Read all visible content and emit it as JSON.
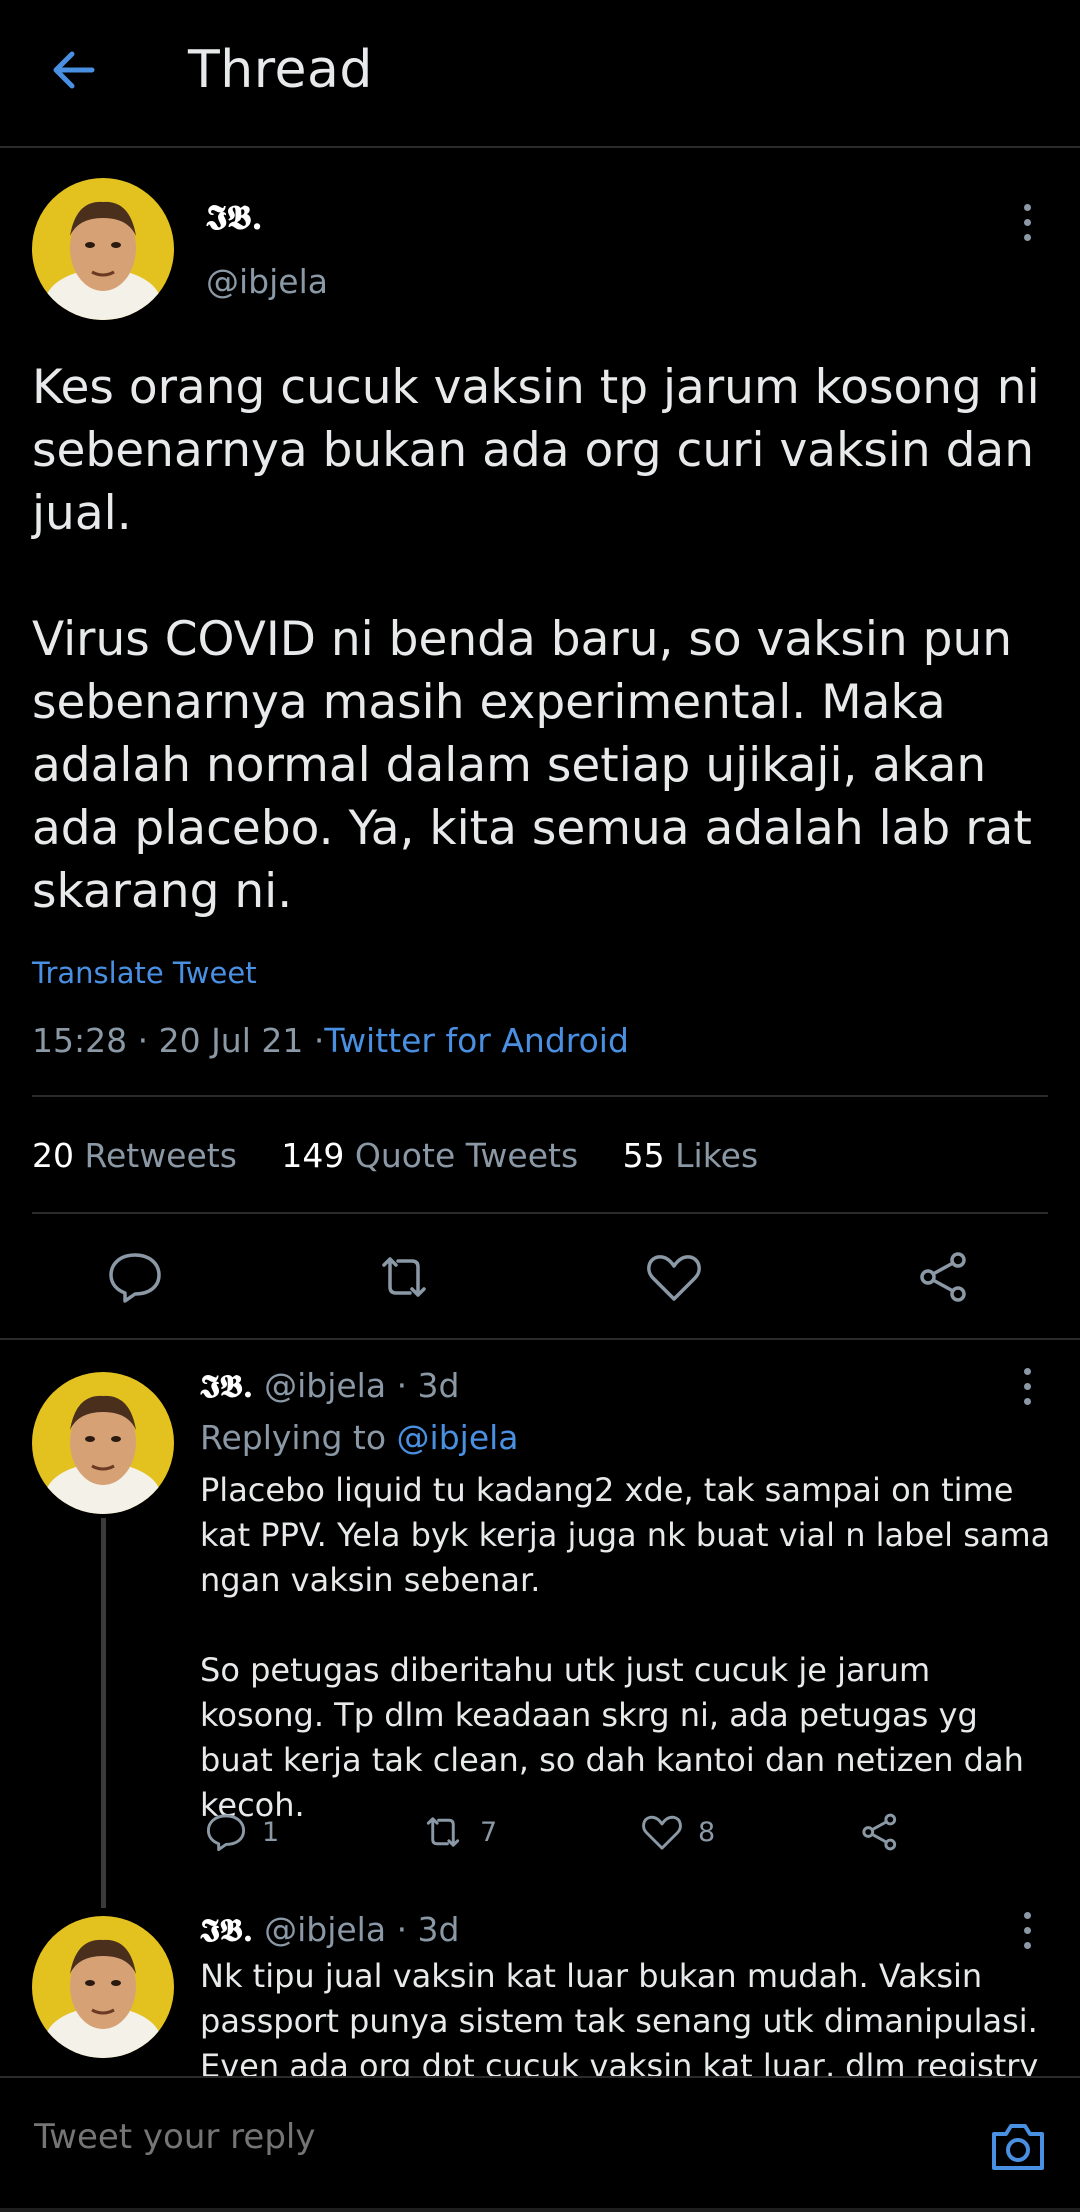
{
  "header": {
    "title": "Thread",
    "back_icon": "arrow-left-icon"
  },
  "main_tweet": {
    "name": "𝕴𝕭.",
    "handle": "@ibjela",
    "text": "Kes orang cucuk vaksin tp jarum kosong ni sebenarnya bukan ada org curi vaksin dan jual.\n\nVirus COVID ni benda baru, so vaksin pun sebenarnya masih experimental. Maka adalah normal dalam setiap ujikaji, akan ada placebo. Ya, kita semua adalah lab rat skarang ni.",
    "translate": "Translate Tweet",
    "time": "15:28",
    "date": "20 Jul 21",
    "source": "Twitter for Android",
    "stats": {
      "retweets_count": "20",
      "retweets_label": "Retweets",
      "quotes_count": "149",
      "quotes_label": "Quote Tweets",
      "likes_count": "55",
      "likes_label": "Likes"
    }
  },
  "replies": [
    {
      "name": "𝕴𝕭.",
      "handle": "@ibjela",
      "time": "3d",
      "replying_label": "Replying to",
      "replying_to": "@ibjela",
      "text": "Placebo liquid tu kadang2 xde, tak sampai on time kat PPV. Yela byk kerja juga nk buat vial n label sama ngan vaksin sebenar.\n\nSo petugas diberitahu utk just cucuk je jarum kosong. Tp dlm keadaan skrg ni, ada petugas yg buat kerja tak clean, so dah kantoi dan netizen dah kecoh.",
      "reply_count": "1",
      "retweet_count": "7",
      "like_count": "8"
    },
    {
      "name": "𝕴𝕭.",
      "handle": "@ibjela",
      "time": "3d",
      "text": "Nk tipu jual vaksin kat luar bukan mudah. Vaksin passport punya sistem tak senang utk dimanipulasi. Even ada org dpt cucuk vaksin kat luar, dlm registry"
    }
  ],
  "reply_bar": {
    "placeholder": "Tweet your reply",
    "icon": "camera-icon"
  },
  "colors": {
    "background": "#000000",
    "accent": "#4a90e2",
    "secondary_text": "#8b98a5",
    "divider": "#2a2a2a"
  }
}
